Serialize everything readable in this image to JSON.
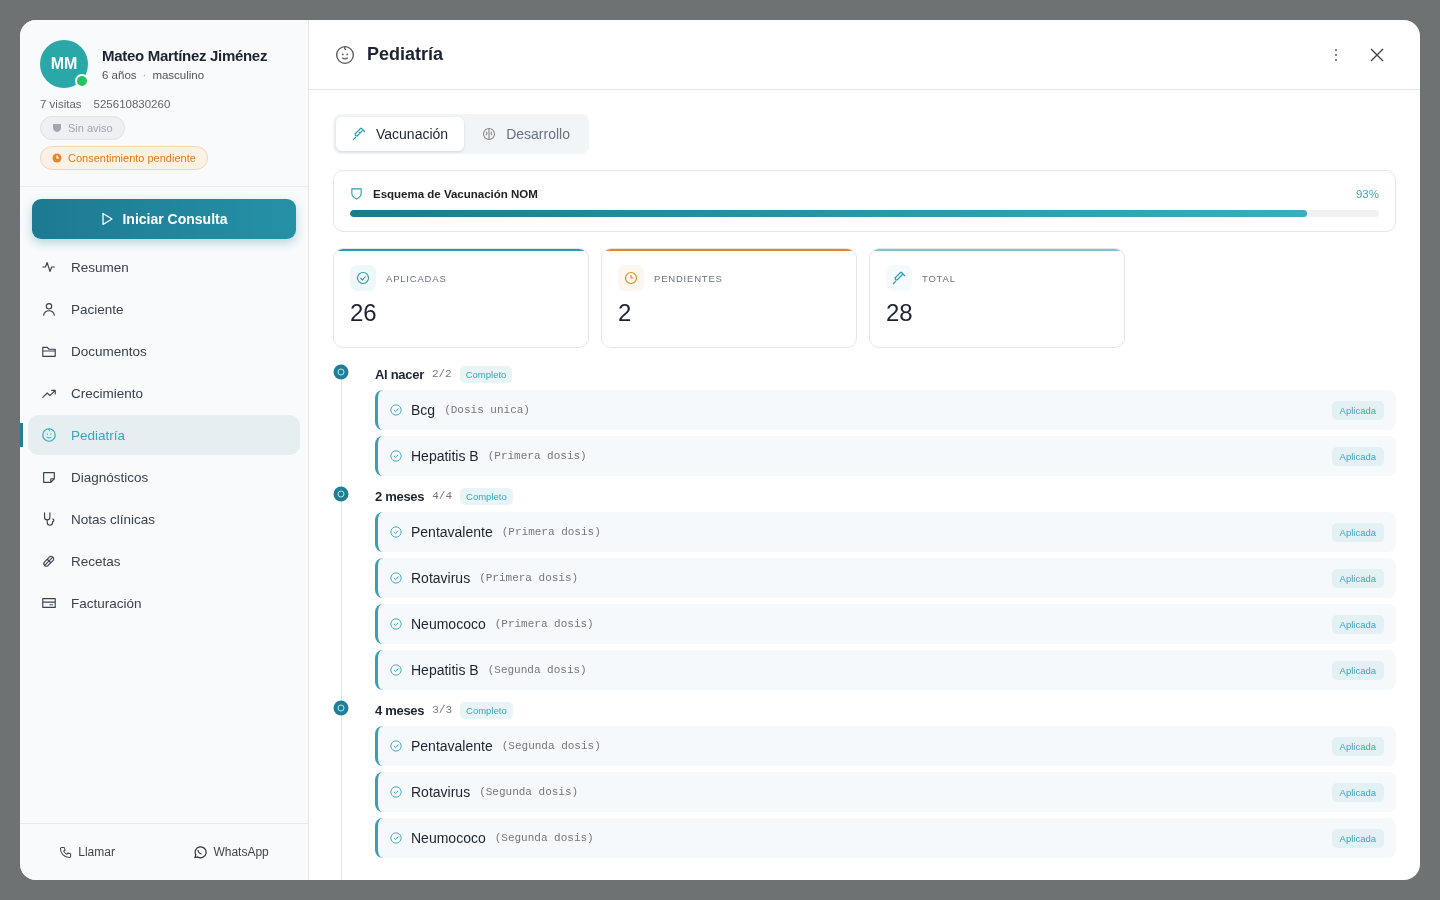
{
  "patient": {
    "initials": "MM",
    "online": true,
    "name": "Mateo Martínez Jiménez",
    "age": "6 años",
    "separator": "·",
    "sex": "masculino",
    "visits": "7 visitas",
    "phone": "525610830260",
    "tags": [
      {
        "kind": "neutral",
        "label": "Sin aviso"
      },
      {
        "kind": "warning",
        "label": "Consentimiento pendiente"
      }
    ]
  },
  "start_button": "Iniciar Consulta",
  "nav": [
    {
      "label": "Resumen",
      "selected": false
    },
    {
      "label": "Paciente",
      "selected": false
    },
    {
      "label": "Documentos",
      "selected": false
    },
    {
      "label": "Crecimiento",
      "selected": false
    },
    {
      "label": "Pediatría",
      "selected": true
    },
    {
      "label": "Diagnósticos",
      "selected": false
    },
    {
      "label": "Notas clínicas",
      "selected": false
    },
    {
      "label": "Recetas",
      "selected": false
    },
    {
      "label": "Facturación",
      "selected": false
    }
  ],
  "footer": {
    "call": "Llamar",
    "whatsapp": "WhatsApp"
  },
  "header": {
    "title": "Pediatría"
  },
  "tabs": [
    {
      "label": "Vacunación",
      "selected": true
    },
    {
      "label": "Desarrollo",
      "selected": false
    }
  ],
  "scheme": {
    "title": "Esquema de Vacunación NOM",
    "percent": "93%",
    "level": 0.93
  },
  "stats": [
    {
      "label": "APLICADAS",
      "value": "26",
      "color": "#2a9bb0"
    },
    {
      "label": "PENDIENTES",
      "value": "2",
      "color": "#e0892c"
    },
    {
      "label": "TOTAL",
      "value": "28",
      "color": "#7cc4d4"
    }
  ],
  "groups": [
    {
      "label": "Al nacer",
      "count": "2/2",
      "badge": "Completo",
      "vaccines": [
        {
          "name": "Bcg",
          "dose": "(Dosis unica)",
          "status": "Aplicada"
        },
        {
          "name": "Hepatitis B",
          "dose": "(Primera dosis)",
          "status": "Aplicada"
        }
      ]
    },
    {
      "label": "2 meses",
      "count": "4/4",
      "badge": "Completo",
      "vaccines": [
        {
          "name": "Pentavalente",
          "dose": "(Primera dosis)",
          "status": "Aplicada"
        },
        {
          "name": "Rotavirus",
          "dose": "(Primera dosis)",
          "status": "Aplicada"
        },
        {
          "name": "Neumococo",
          "dose": "(Primera dosis)",
          "status": "Aplicada"
        },
        {
          "name": "Hepatitis B",
          "dose": "(Segunda dosis)",
          "status": "Aplicada"
        }
      ]
    },
    {
      "label": "4 meses",
      "count": "3/3",
      "badge": "Completo",
      "vaccines": [
        {
          "name": "Pentavalente",
          "dose": "(Segunda dosis)",
          "status": "Aplicada"
        },
        {
          "name": "Rotavirus",
          "dose": "(Segunda dosis)",
          "status": "Aplicada"
        },
        {
          "name": "Neumococo",
          "dose": "(Segunda dosis)",
          "status": "Aplicada"
        }
      ]
    }
  ]
}
